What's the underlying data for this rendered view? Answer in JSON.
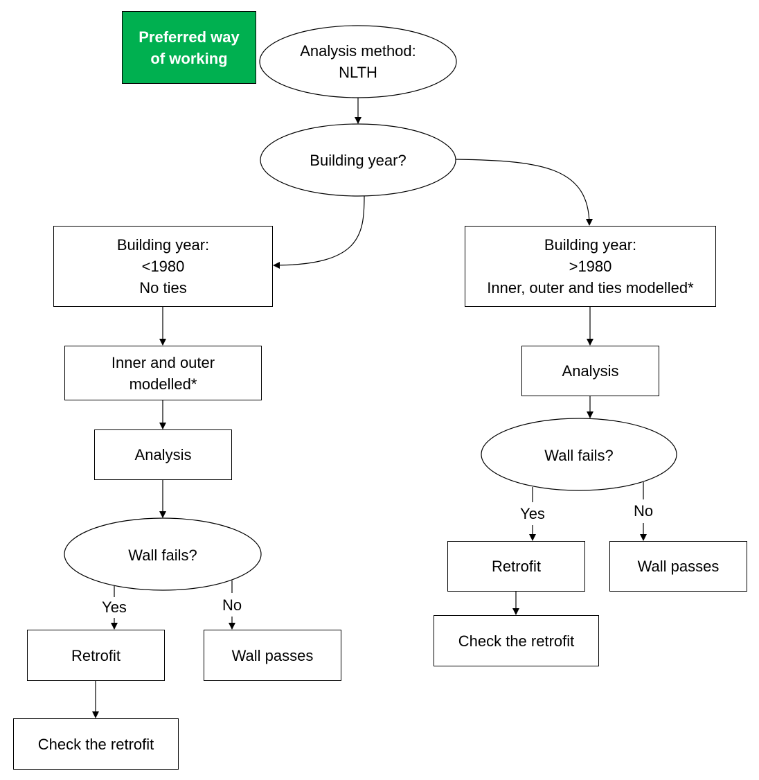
{
  "legend": {
    "label": "Preferred way\nof working",
    "color": "#00b050"
  },
  "nodes": {
    "start": "Analysis method:\nNLTH",
    "year_question": "Building year?",
    "left_year": "Building year:\n<1980\nNo ties",
    "right_year": "Building year:\n>1980\nInner, outer and ties modelled*",
    "left_model": "Inner and outer\nmodelled*",
    "left_analysis": "Analysis",
    "right_analysis": "Analysis",
    "left_decision": "Wall fails?",
    "right_decision": "Wall fails?",
    "left_retrofit": "Retrofit",
    "left_pass": "Wall passes",
    "left_check": "Check the retrofit",
    "right_retrofit": "Retrofit",
    "right_pass": "Wall passes",
    "right_check": "Check the retrofit"
  },
  "edge_labels": {
    "yes": "Yes",
    "no": "No"
  }
}
